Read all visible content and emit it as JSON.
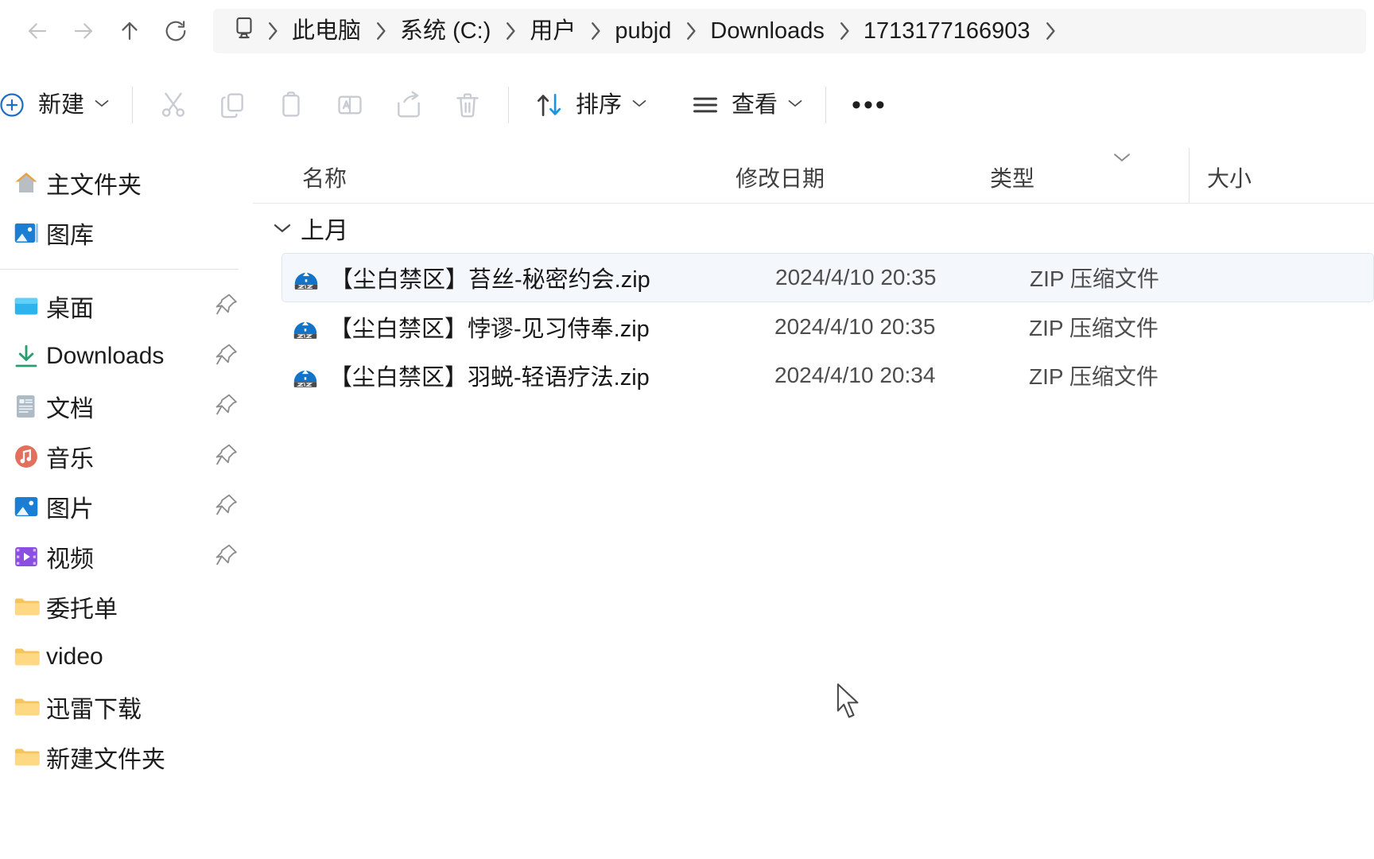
{
  "nav": {
    "back_icon": "arrow-left-icon",
    "forward_icon": "arrow-right-icon",
    "up_icon": "arrow-up-icon",
    "refresh_icon": "refresh-icon"
  },
  "breadcrumb": {
    "root_icon": "this-pc-icon",
    "items": [
      {
        "label": "此电脑"
      },
      {
        "label": "系统 (C:)"
      },
      {
        "label": "用户"
      },
      {
        "label": "pubjd"
      },
      {
        "label": "Downloads"
      },
      {
        "label": "1713177166903"
      }
    ]
  },
  "toolbar": {
    "new_label": "新建",
    "new_icon": "plus-circle-icon",
    "cut_icon": "scissors-icon",
    "copy_icon": "copy-icon",
    "paste_icon": "paste-icon",
    "rename_icon": "rename-icon",
    "share_icon": "share-icon",
    "delete_icon": "trash-icon",
    "sort_label": "排序",
    "sort_icon": "sort-arrows-icon",
    "view_label": "查看",
    "view_icon": "list-lines-icon",
    "more_label": "•••"
  },
  "sidebar": {
    "items": [
      {
        "label": "主文件夹",
        "icon": "home-icon",
        "pinned": false
      },
      {
        "label": "图库",
        "icon": "gallery-icon",
        "pinned": false
      },
      {
        "label": "桌面",
        "icon": "desktop-icon",
        "pinned": true
      },
      {
        "label": "Downloads",
        "icon": "downloads-icon",
        "pinned": true
      },
      {
        "label": "文档",
        "icon": "documents-icon",
        "pinned": true
      },
      {
        "label": "音乐",
        "icon": "music-icon",
        "pinned": true
      },
      {
        "label": "图片",
        "icon": "pictures-icon",
        "pinned": true
      },
      {
        "label": "视频",
        "icon": "videos-icon",
        "pinned": true
      },
      {
        "label": "委托单",
        "icon": "folder-icon",
        "pinned": false
      },
      {
        "label": "video",
        "icon": "folder-icon",
        "pinned": false
      },
      {
        "label": "迅雷下载",
        "icon": "folder-icon",
        "pinned": false
      },
      {
        "label": "新建文件夹",
        "icon": "folder-icon",
        "pinned": false
      }
    ]
  },
  "columns": {
    "name": "名称",
    "date": "修改日期",
    "type": "类型",
    "size": "大小"
  },
  "group": {
    "label": "上月",
    "caret_icon": "chevron-down-icon"
  },
  "files": [
    {
      "name": "【尘白禁区】苔丝-秘密约会.zip",
      "date": "2024/4/10 20:35",
      "type": "ZIP 压缩文件",
      "size": "",
      "icon": "zip-archive-icon",
      "selected": true
    },
    {
      "name": "【尘白禁区】悖谬-见习侍奉.zip",
      "date": "2024/4/10 20:35",
      "type": "ZIP 压缩文件",
      "size": "",
      "icon": "zip-archive-icon",
      "selected": false
    },
    {
      "name": "【尘白禁区】羽蜕-轻语疗法.zip",
      "date": "2024/4/10 20:34",
      "type": "ZIP 压缩文件",
      "size": "",
      "icon": "zip-archive-icon",
      "selected": false
    }
  ],
  "colors": {
    "accent_blue": "#0a7bd6",
    "folder_yellow": "#f7c352",
    "selection_bg": "#f4f8fc",
    "text_primary": "#1c1c1c",
    "text_secondary": "#4d4d4d"
  }
}
